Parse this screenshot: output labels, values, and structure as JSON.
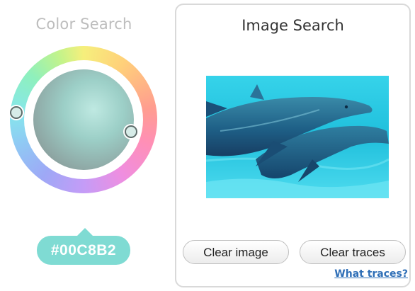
{
  "color_search": {
    "title": "Color Search",
    "selected_hex": "#00C8B2",
    "badge_color": "#7fdbd3"
  },
  "image_search": {
    "title": "Image Search",
    "clear_image_label": "Clear image",
    "clear_traces_label": "Clear traces",
    "what_traces_link": "What traces?"
  },
  "colors": {
    "link": "#2f6fb7",
    "panel_border": "#d9d9d9",
    "muted_title": "#bdbdbd"
  }
}
